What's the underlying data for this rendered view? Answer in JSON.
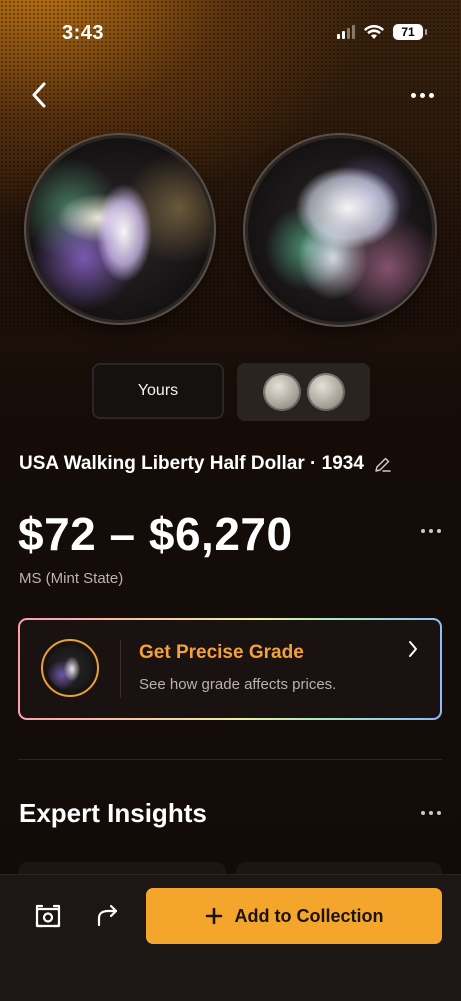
{
  "status_bar": {
    "time": "3:43",
    "battery": "71"
  },
  "nav": {
    "back_icon": "chevron-left-icon",
    "more_icon": "more-horizontal-icon"
  },
  "image_tabs": {
    "yours_label": "Yours"
  },
  "coin": {
    "title": "USA Walking Liberty Half Dollar · 1934",
    "price_range": "$72 – $6,270",
    "grade": "MS (Mint State)"
  },
  "grade_card": {
    "heading": "Get Precise Grade",
    "subtitle": "See how grade affects prices."
  },
  "insights": {
    "title": "Expert Insights"
  },
  "bottom_bar": {
    "add_label": "Add to Collection"
  },
  "colors": {
    "accent": "#f4a62c",
    "grade_heading": "#f3a23a",
    "background": "#120b08"
  }
}
